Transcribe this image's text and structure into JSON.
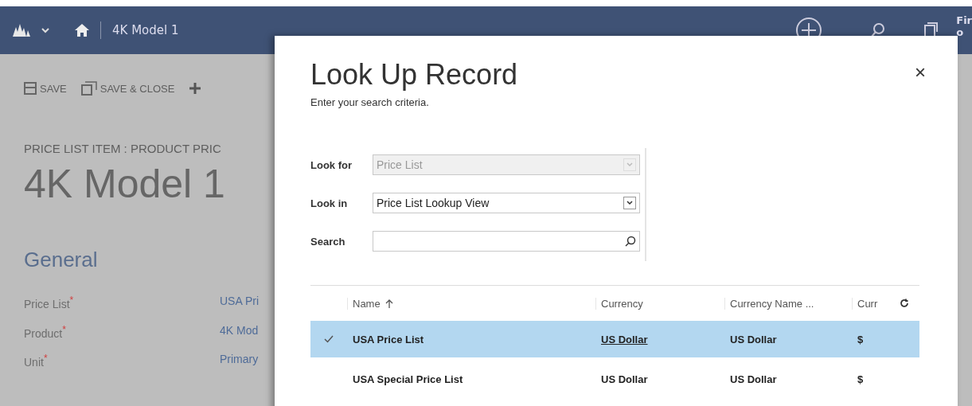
{
  "top_bar": {
    "breadcrumb": "4K Model 1",
    "user_line_1": "Fir",
    "user_line_2": "o"
  },
  "command_bar": [
    "SAVE",
    "SAVE & CLOSE"
  ],
  "record": {
    "entity": "PRICE LIST ITEM : PRODUCT PRIC",
    "title": "4K Model 1",
    "section": "General",
    "fields": [
      {
        "label": "Price List",
        "required_mark": "*",
        "value": "USA Pri"
      },
      {
        "label": "Product",
        "required_mark": "*",
        "value": "4K Mod"
      },
      {
        "label": "Unit",
        "required_mark": "*",
        "value": "Primary"
      }
    ]
  },
  "dialog": {
    "title": "Look Up Record",
    "subtitle": "Enter your search criteria.",
    "close": "×",
    "criteria": [
      {
        "kind": "dropdown",
        "label": "Look for",
        "value": "Price List",
        "disabled": true
      },
      {
        "kind": "dropdown",
        "label": "Look in",
        "value": "Price List Lookup View",
        "disabled": false
      },
      {
        "kind": "search",
        "label": "Search"
      }
    ],
    "table": {
      "columns": [
        {
          "label": "Name",
          "sorted": true
        },
        {
          "label": "Currency",
          "sorted": false
        },
        {
          "label": "Currency Name ...",
          "sorted": false
        },
        {
          "label": "Curr",
          "sorted": false
        }
      ],
      "rows": [
        {
          "selected": true,
          "name": "USA Price List",
          "currency": "US Dollar",
          "currency_underlined": true,
          "currency_name": "US Dollar",
          "curr": "$"
        },
        {
          "selected": false,
          "name": "USA Special Price List",
          "currency": "US Dollar",
          "currency_underlined": false,
          "currency_name": "US Dollar",
          "curr": "$"
        }
      ]
    }
  }
}
